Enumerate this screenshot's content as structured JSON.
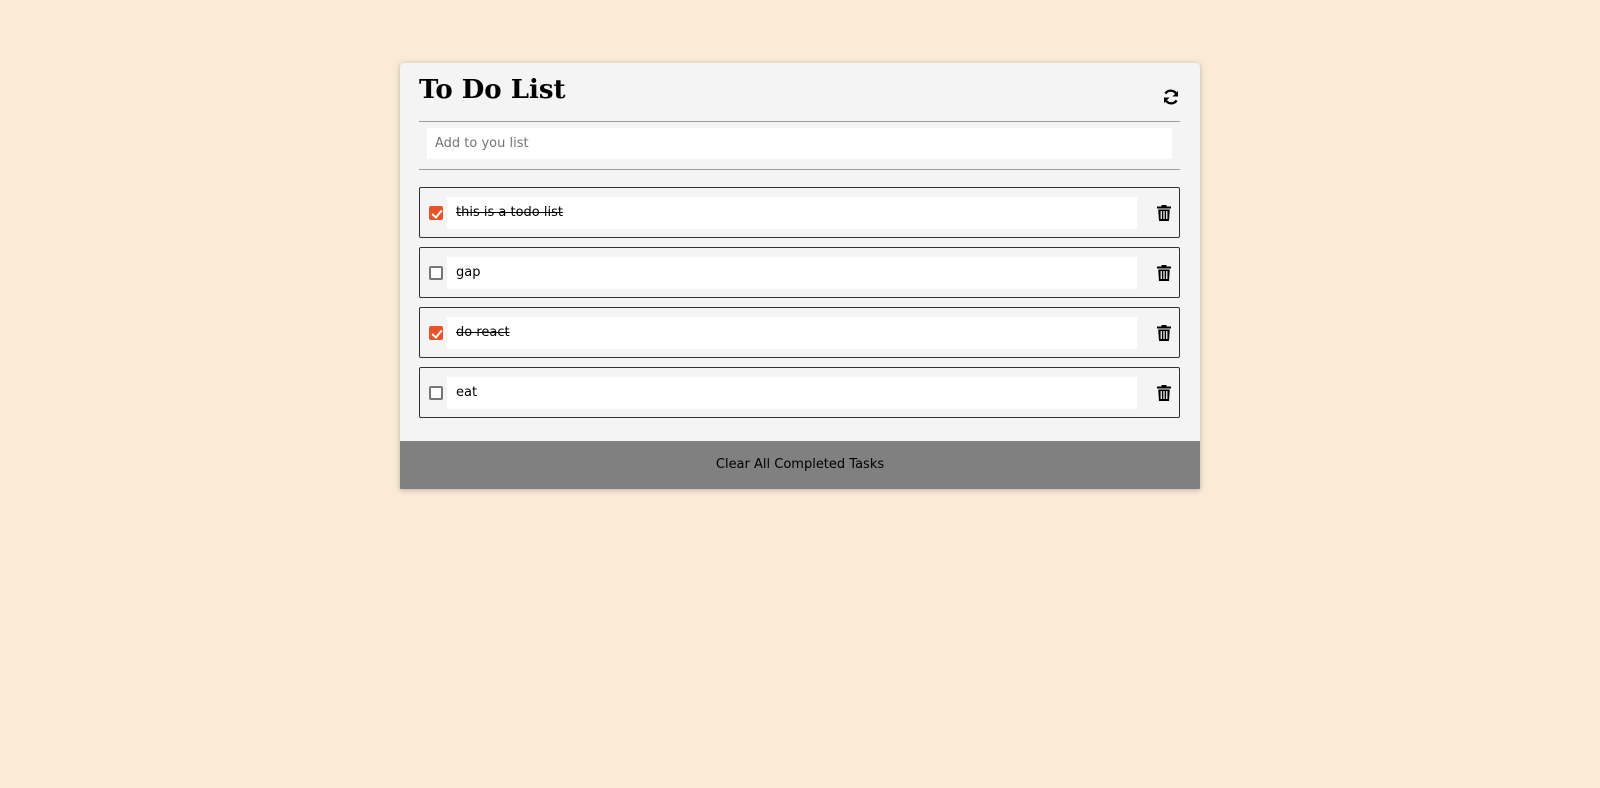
{
  "header": {
    "title": "To Do List",
    "refresh_icon": "refresh-icon"
  },
  "add": {
    "placeholder": "Add to you list",
    "value": ""
  },
  "todos": [
    {
      "text": "this is a todo list",
      "completed": true
    },
    {
      "text": "gap",
      "completed": false
    },
    {
      "text": "do react ",
      "completed": true
    },
    {
      "text": "eat",
      "completed": false
    }
  ],
  "footer": {
    "clear_label": "Clear All Completed Tasks"
  },
  "colors": {
    "page_background": "#faebd7",
    "card_background": "#f4f4f4",
    "checkbox_accent": "#e8542a",
    "footer_background": "#808080"
  },
  "icons": {
    "item_delete": "trash-icon",
    "item_checkbox": "checkbox"
  }
}
